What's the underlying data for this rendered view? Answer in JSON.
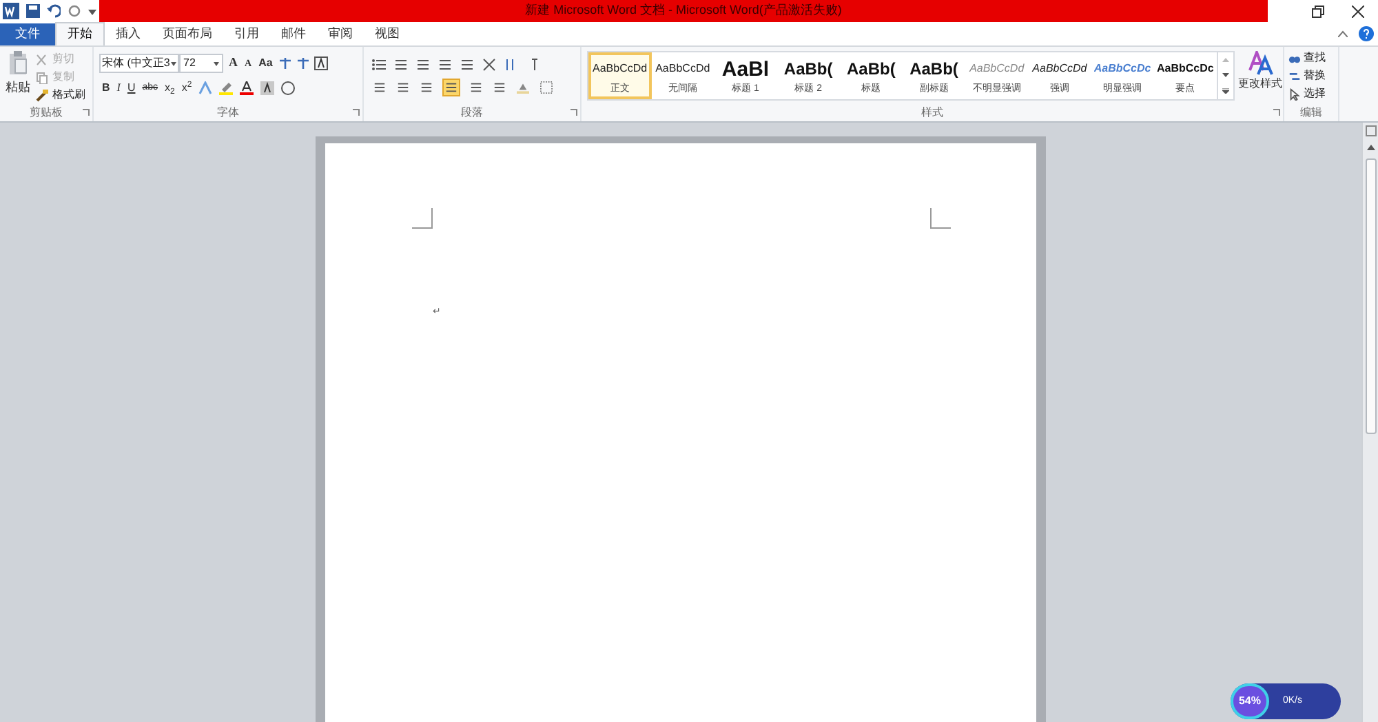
{
  "title_bar": {
    "title": "新建 Microsoft Word 文档 - Microsoft Word(产品激活失败)"
  },
  "tabs": [
    {
      "label": "文件",
      "kind": "file",
      "selected": false
    },
    {
      "label": "开始",
      "kind": "tab",
      "selected": true
    },
    {
      "label": "插入",
      "kind": "tab",
      "selected": false
    },
    {
      "label": "页面布局",
      "kind": "tab",
      "selected": false
    },
    {
      "label": "引用",
      "kind": "tab",
      "selected": false
    },
    {
      "label": "邮件",
      "kind": "tab",
      "selected": false
    },
    {
      "label": "审阅",
      "kind": "tab",
      "selected": false
    },
    {
      "label": "视图",
      "kind": "tab",
      "selected": false
    }
  ],
  "clipboard": {
    "group_label": "剪贴板",
    "paste": "粘贴",
    "items": [
      {
        "label": "剪切",
        "disabled": true
      },
      {
        "label": "复制",
        "disabled": true
      },
      {
        "label": "格式刷",
        "disabled": false
      }
    ]
  },
  "font": {
    "group_label": "字体",
    "font_name": "宋体 (中文正3",
    "font_size": "72",
    "row1": [
      "A",
      "A",
      "Aa"
    ],
    "row2": [
      "B",
      "I",
      "U",
      "abc",
      "x$_{2}$",
      "x$^{2}$"
    ]
  },
  "paragraph": {
    "group_label": "段落"
  },
  "styles": {
    "group_label": "样式",
    "change_styles": "更改样式",
    "items": [
      {
        "sample": "AaBbCcDd",
        "label": "正文",
        "kind": "normal",
        "selected": true
      },
      {
        "sample": "AaBbCcDd",
        "label": "无间隔",
        "kind": "normal",
        "selected": false
      },
      {
        "sample": "AaBl",
        "label": "标题 1",
        "kind": "big",
        "selected": false
      },
      {
        "sample": "AaBb(",
        "label": "标题 2",
        "kind": "heading",
        "selected": false
      },
      {
        "sample": "AaBb(",
        "label": "标题",
        "kind": "heading",
        "selected": false
      },
      {
        "sample": "AaBb(",
        "label": "副标题",
        "kind": "heading",
        "selected": false
      },
      {
        "sample": "AaBbCcDd",
        "label": "不明显强调",
        "kind": "subtle",
        "selected": false
      },
      {
        "sample": "AaBbCcDd",
        "label": "强调",
        "kind": "emphasis",
        "selected": false
      },
      {
        "sample": "AaBbCcDc",
        "label": "明显强调",
        "kind": "intense",
        "selected": false
      },
      {
        "sample": "AaBbCcDc",
        "label": "要点",
        "kind": "strong",
        "selected": false
      }
    ]
  },
  "editing": {
    "group_label": "编辑",
    "items": [
      "查找",
      "替换",
      "选择"
    ]
  },
  "document": {
    "paragraph_mark": "↵"
  },
  "speed_widget": {
    "percent": "54%",
    "speed": "0K/s"
  }
}
